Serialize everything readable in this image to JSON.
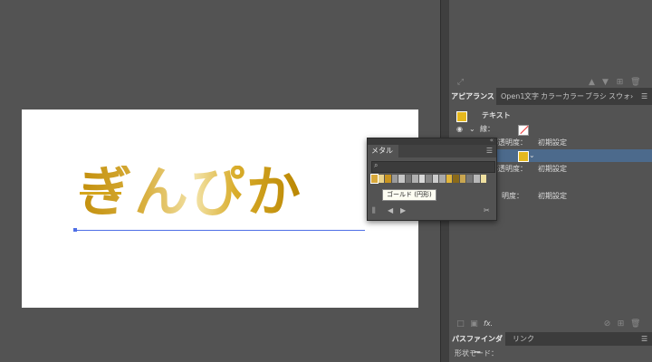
{
  "panels": {
    "tabs": [
      "アピアランス",
      "Open1",
      "文字",
      "カラー",
      "カラー",
      "ブラシ",
      "スウォ"
    ],
    "tabs_overflow": "›",
    "pathfinder_tabs": [
      "パスファインダー",
      "リンク"
    ],
    "pathfinder_label": "形状モード："
  },
  "appearance": {
    "title": "テキスト",
    "stroke_label": "線：",
    "rows": [
      {
        "label": "不透明度：",
        "value": "初期設定"
      },
      {
        "label": "不透明度：",
        "value": "初期設定"
      },
      {
        "label": "明度：",
        "value": "初期設定"
      }
    ],
    "fx_label": "fx."
  },
  "canvas": {
    "text": "ぎんぴか"
  },
  "metal_panel": {
    "tab_label": "メタル",
    "tooltip": "ゴールド (円形)",
    "colors": [
      "#d8a83a",
      "#e9d38b",
      "#c89420",
      "#9a9a9a",
      "#c6c6c6",
      "#777777",
      "#b0b0b0",
      "#d9d9d9",
      "#888888",
      "#cccccc",
      "#a8a8a8",
      "#e1b53a",
      "#8a6a1a",
      "#c9a650",
      "#777777",
      "#b8b8b8",
      "#efe0a0"
    ]
  },
  "colors": {
    "accent_selected": "#4c6a8c",
    "path": "#4f6fe6",
    "gold": "#d4a51b"
  }
}
